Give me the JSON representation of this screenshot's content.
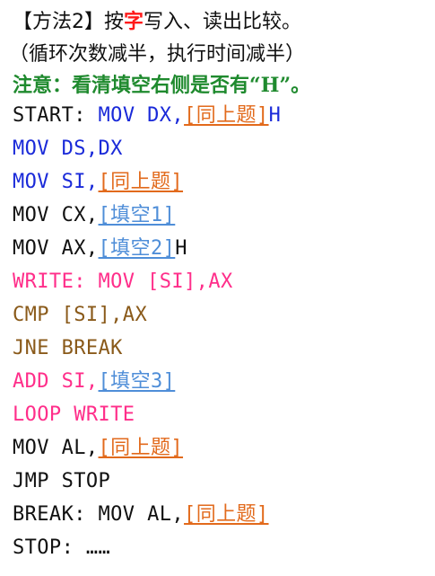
{
  "title": {
    "prefix": "【方法2】按",
    "highlight": "字",
    "suffix": "写入、读出比较。"
  },
  "subtitle": "（循环次数减半，执行时间减半）",
  "note": "注意：看清填空右侧是否有“H”。",
  "code": [
    {
      "segments": [
        {
          "text": "START: ",
          "color": "#111111"
        },
        {
          "text": "MOV DX,",
          "color": "#1a2ad9"
        },
        {
          "text": "[同上题]",
          "color": "#e26a1c",
          "blank": true
        },
        {
          "text": "H",
          "color": "#1a2ad9"
        }
      ]
    },
    {
      "segments": [
        {
          "text": "MOV DS,DX",
          "color": "#1a2ad9"
        }
      ]
    },
    {
      "segments": [
        {
          "text": "MOV SI,",
          "color": "#1a2ad9"
        },
        {
          "text": "[同上题]",
          "color": "#e26a1c",
          "blank": true
        }
      ]
    },
    {
      "segments": [
        {
          "text": "MOV CX,",
          "color": "#111111"
        },
        {
          "text": "[填空1]",
          "color": "#4f8ed8",
          "blank": true
        }
      ]
    },
    {
      "segments": [
        {
          "text": "MOV AX,",
          "color": "#111111"
        },
        {
          "text": "[填空2]",
          "color": "#4f8ed8",
          "blank": true
        },
        {
          "text": "H",
          "color": "#111111"
        }
      ]
    },
    {
      "segments": [
        {
          "text": "WRITE: MOV [SI],AX",
          "color": "#ff2e8a"
        }
      ]
    },
    {
      "segments": [
        {
          "text": "CMP [SI],AX",
          "color": "#8a5a1a"
        }
      ]
    },
    {
      "segments": [
        {
          "text": "JNE BREAK",
          "color": "#8a5a1a"
        }
      ]
    },
    {
      "segments": [
        {
          "text": "ADD SI,",
          "color": "#ff2e8a"
        },
        {
          "text": "[填空3]",
          "color": "#4f8ed8",
          "blank": true
        }
      ]
    },
    {
      "segments": [
        {
          "text": "LOOP WRITE",
          "color": "#ff2e8a"
        }
      ]
    },
    {
      "segments": [
        {
          "text": "MOV AL,",
          "color": "#111111"
        },
        {
          "text": "[同上题]",
          "color": "#e26a1c",
          "blank": true
        }
      ]
    },
    {
      "segments": [
        {
          "text": "JMP STOP",
          "color": "#111111"
        }
      ]
    },
    {
      "segments": [
        {
          "text": "BREAK: MOV AL,",
          "color": "#111111"
        },
        {
          "text": "[同上题]",
          "color": "#e26a1c",
          "blank": true
        }
      ]
    },
    {
      "segments": [
        {
          "text": "STOP: ……",
          "color": "#111111"
        }
      ]
    }
  ]
}
